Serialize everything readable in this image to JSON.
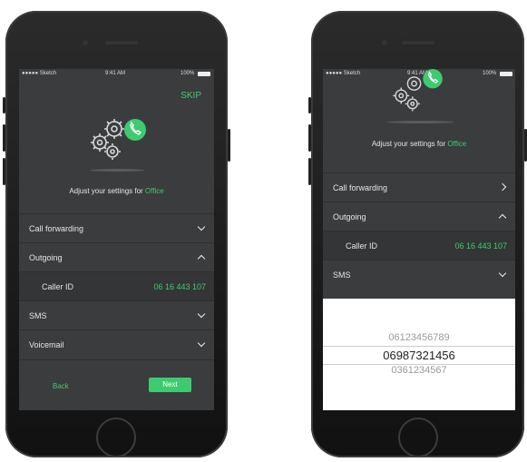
{
  "left_phone": {
    "status": {
      "carrier": "●●●●● Sketch",
      "time": "9:41 AM",
      "battery": "100%"
    },
    "skip_label": "SKIP",
    "settings_prefix": "Adjust your settings for ",
    "settings_target": "Office",
    "rows": {
      "call_forwarding": "Call forwarding",
      "outgoing": "Outgoing",
      "caller_id_label": "Caller ID",
      "caller_id_value": "06 16 443 107",
      "sms": "SMS",
      "voicemail": "Voicemail"
    },
    "back_label": "Back",
    "next_label": "Next"
  },
  "right_phone": {
    "status": {
      "carrier": "●●●●● Sketch",
      "time": "9:41 AM",
      "battery": "100%"
    },
    "settings_prefix": "Adjust your settings for ",
    "settings_target": "Office",
    "rows": {
      "call_forwarding": "Call forwarding",
      "outgoing": "Outgoing",
      "caller_id_label": "Caller ID",
      "caller_id_value": "06 16 443 107",
      "sms": "SMS"
    },
    "picker_options": [
      "06123456789",
      "06987321456",
      "0361234567"
    ]
  },
  "colors": {
    "accent": "#3ecb70",
    "screen_bg": "#3b3c3e"
  },
  "icons": [
    "gears-icon",
    "phone-settings-icon",
    "chevron-down-icon",
    "chevron-up-icon",
    "chevron-right-icon"
  ]
}
